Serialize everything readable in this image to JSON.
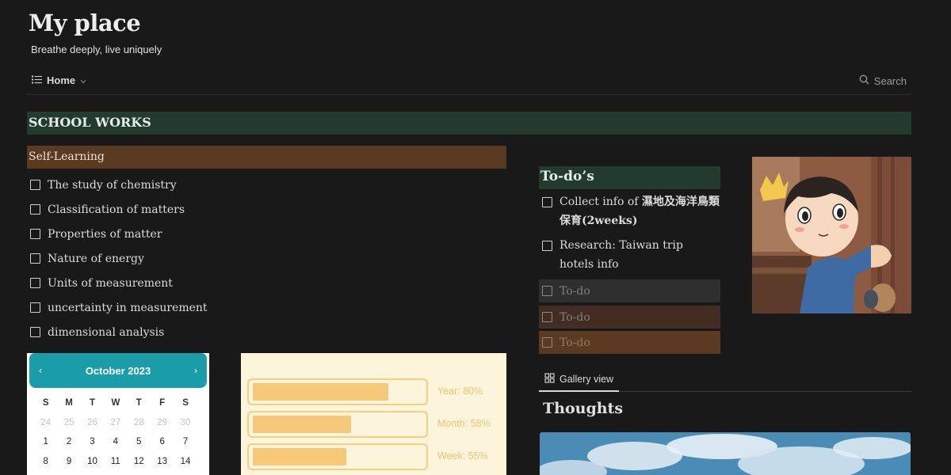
{
  "header": {
    "title": "My place",
    "subtitle": "Breathe deeply, live uniquely"
  },
  "nav": {
    "home_label": "Home",
    "search_label": "Search"
  },
  "school": {
    "section_title": "SCHOOL WORKS",
    "subheader": "Self-Learning",
    "items": [
      "The study of chemistry",
      "Classification of matters",
      "Properties of matter",
      "Nature of energy",
      "Units of measurement",
      "uncertainty in measurement",
      "dimensional analysis"
    ]
  },
  "todos": {
    "title": "To-do’s",
    "items": [
      {
        "text_a": "Collect info of ",
        "text_b": "濕地及海洋鳥類保育(2weeks)"
      },
      {
        "text": "Research: Taiwan trip hotels info"
      }
    ],
    "placeholders": [
      "To-do",
      "To-do",
      "To-do"
    ]
  },
  "gallery": {
    "tab_label": "Gallery view",
    "title": "Thoughts"
  },
  "calendar": {
    "month": "October 2023",
    "dows": [
      "S",
      "M",
      "T",
      "W",
      "T",
      "F",
      "S"
    ],
    "prev_days": [
      "24",
      "25",
      "26",
      "27",
      "28",
      "29",
      "30"
    ],
    "days": [
      "1",
      "2",
      "3",
      "4",
      "5",
      "6",
      "7",
      "8",
      "9",
      "10",
      "11",
      "12",
      "13",
      "14"
    ]
  },
  "progress": [
    {
      "label": "Year: 80%",
      "value": 80
    },
    {
      "label": "Month: 58%",
      "value": 58
    },
    {
      "label": "Week: 55%",
      "value": 55
    }
  ],
  "colors": {
    "background": "#191919",
    "green_header": "#233b2e",
    "brown_header": "#5a3b21",
    "calendar_accent": "#1b9ca9",
    "progress_fill": "#f6c87a"
  },
  "icons": {
    "home": "list-icon",
    "dropdown": "chevron-down-icon",
    "search": "search-icon",
    "gallery": "grid-icon",
    "prev": "chevron-left-icon",
    "next": "chevron-right-icon"
  }
}
